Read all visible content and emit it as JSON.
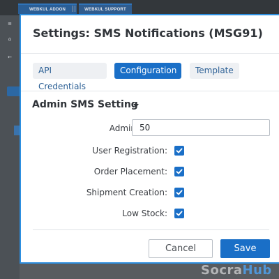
{
  "background": {
    "tabs": [
      {
        "label": "WEBKUL ADDON"
      },
      {
        "label": "WEBKUL SUPPORT"
      }
    ]
  },
  "modal": {
    "title": "Settings: SMS Notifications (MSG91)",
    "tabs": [
      {
        "label": "API Credentials",
        "active": false
      },
      {
        "label": "Configuration",
        "active": true
      },
      {
        "label": "Template",
        "active": false
      }
    ],
    "section": {
      "title": "Admin SMS Setting",
      "expanded": true
    },
    "fields": {
      "admin_phone": {
        "label": "Admin Phone:",
        "value": "50"
      },
      "user_registration": {
        "label": "User Registration:",
        "checked": true
      },
      "order_placement": {
        "label": "Order Placement:",
        "checked": true
      },
      "shipment_creation": {
        "label": "Shipment Creation:",
        "checked": true
      },
      "low_stock": {
        "label": "Low Stock:",
        "checked": true
      }
    },
    "buttons": {
      "cancel": "Cancel",
      "save": "Save"
    }
  },
  "watermark": {
    "part1": "Socra",
    "part2": "Hub"
  },
  "colors": {
    "accent": "#1a6fc7",
    "modal_border": "#2d8fe0"
  },
  "icons": [
    "caret-down-icon",
    "checkmark-icon"
  ]
}
